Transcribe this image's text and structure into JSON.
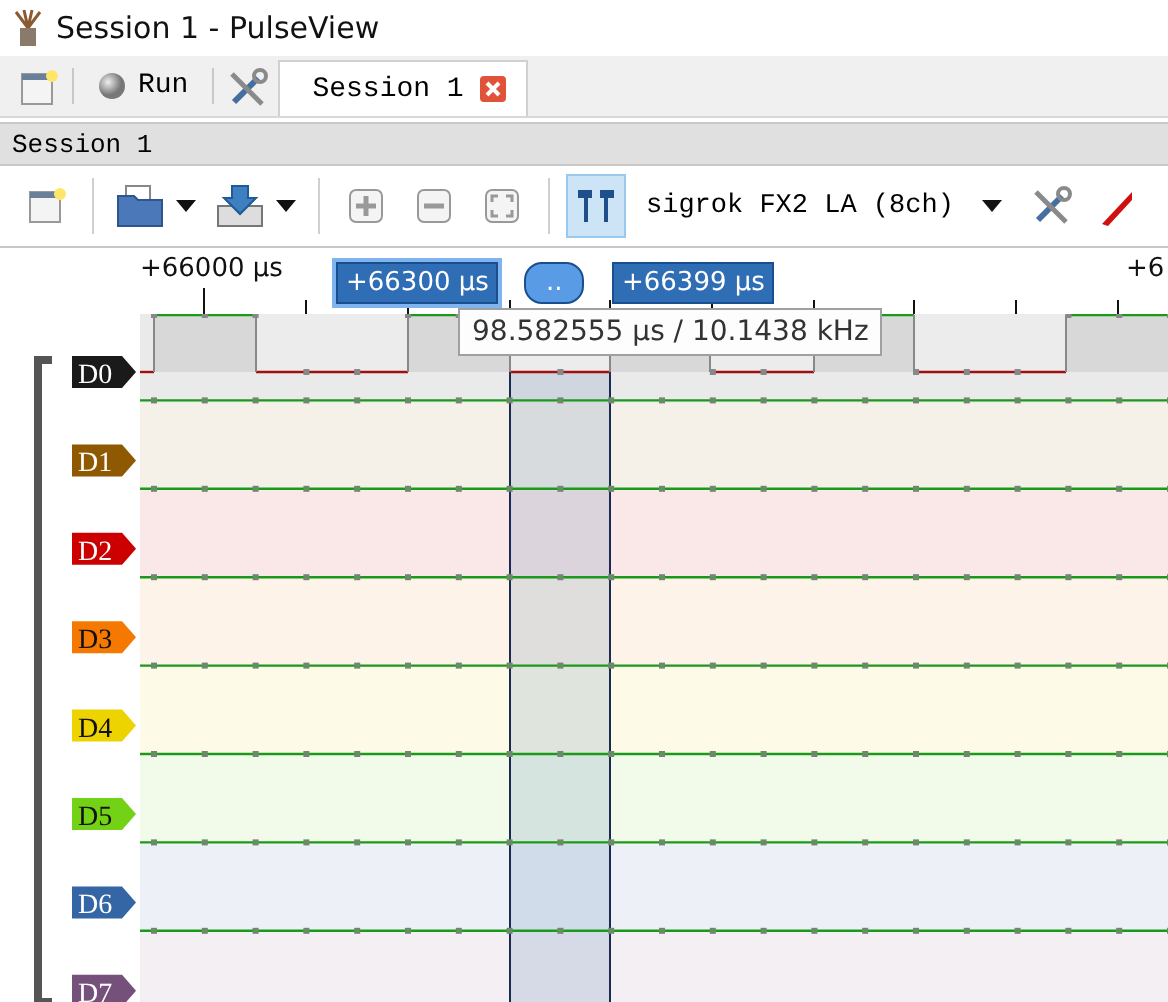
{
  "window": {
    "title": "Session 1 - PulseView"
  },
  "top_bar": {
    "run_button": "Run",
    "tabs": [
      {
        "label": "Session 1",
        "selected": true
      }
    ]
  },
  "session_title": "Session 1",
  "toolbar": {
    "cursor_toggle": {
      "on": true
    },
    "device": "sigrok FX2 LA (8ch)"
  },
  "ruler": {
    "labels": [
      "+66000 μs",
      "+6"
    ],
    "cursor_labels": [
      "+66300 μs",
      "..",
      "+66399 μs"
    ]
  },
  "tooltip": "98.582555 μs / 10.1438 kHz",
  "channels": [
    {
      "name": "D0",
      "color": "#1a1a1a",
      "kind": "pulses"
    },
    {
      "name": "D1",
      "color": "#8f5902",
      "kind": "high"
    },
    {
      "name": "D2",
      "color": "#cc0000",
      "kind": "high"
    },
    {
      "name": "D3",
      "color": "#f57900",
      "kind": "high"
    },
    {
      "name": "D4",
      "color": "#edd400",
      "kind": "high"
    },
    {
      "name": "D5",
      "color": "#73d216",
      "kind": "high"
    },
    {
      "name": "D6",
      "color": "#3465a4",
      "kind": "high"
    },
    {
      "name": "D7",
      "color": "#75507b",
      "kind": "high"
    }
  ]
}
